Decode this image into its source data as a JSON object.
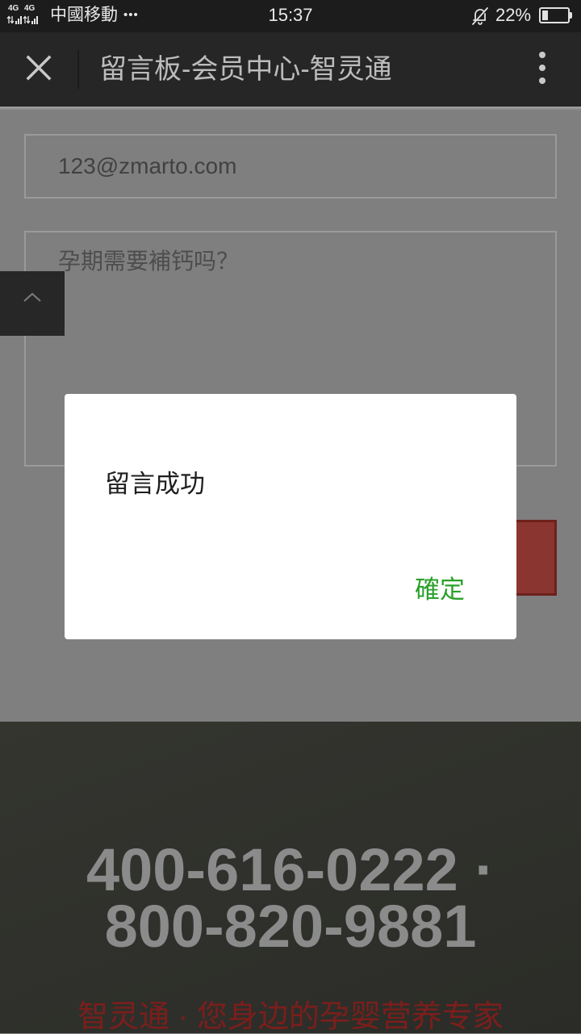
{
  "status_bar": {
    "network_1": "4G",
    "network_2": "4G",
    "carrier": "中國移動",
    "overflow": "•••",
    "time": "15:37",
    "battery_text": "22%",
    "battery_level": 0.22,
    "icons": [
      "signal-icon",
      "bell-off-icon",
      "battery-icon"
    ]
  },
  "title_bar": {
    "title": "留言板-会员中心-智灵通",
    "icons": [
      "close-icon",
      "more-vertical-icon"
    ]
  },
  "form": {
    "email_value": "123@zmarto.com",
    "message_value": "孕期需要補钙吗？"
  },
  "back_to_top": {
    "icon": "chevron-up-icon"
  },
  "footer": {
    "phone_line_1": "400-616-0222 ·",
    "phone_line_2": "800-820-9881",
    "slogan": "智灵通 · 您身边的孕婴营养专家"
  },
  "dialog": {
    "message": "留言成功",
    "confirm_label": "確定"
  },
  "colors": {
    "title_bar": "#262626",
    "confirm_accent": "#2aa12a",
    "submit_button": "#8b3530",
    "slogan": "#7b1e1c"
  }
}
